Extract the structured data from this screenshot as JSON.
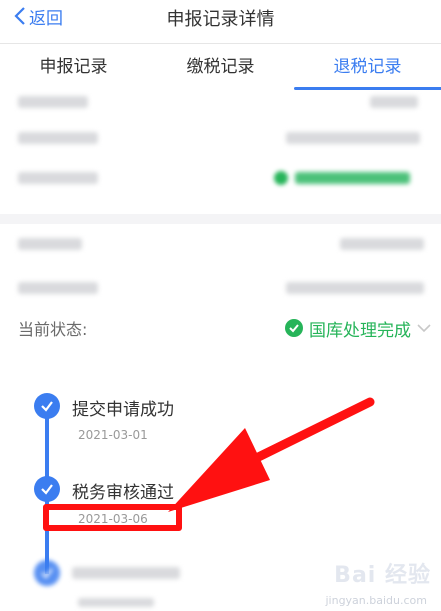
{
  "header": {
    "back_label": "返回",
    "title": "申报记录详情"
  },
  "tabs": [
    {
      "label": "申报记录"
    },
    {
      "label": "缴税记录"
    },
    {
      "label": "退税记录"
    }
  ],
  "active_tab": "退税记录",
  "status": {
    "label": "当前状态:",
    "value": "国库处理完成"
  },
  "timeline": [
    {
      "title": "提交申请成功",
      "date": "2021-03-01"
    },
    {
      "title": "税务审核通过",
      "date": "2021-03-06"
    }
  ],
  "colors": {
    "accent": "#3b7df0",
    "success": "#26b459",
    "highlight": "#ff1111"
  },
  "watermark": {
    "text": "Bai 经验",
    "sub": "jingyan.baidu.com"
  }
}
